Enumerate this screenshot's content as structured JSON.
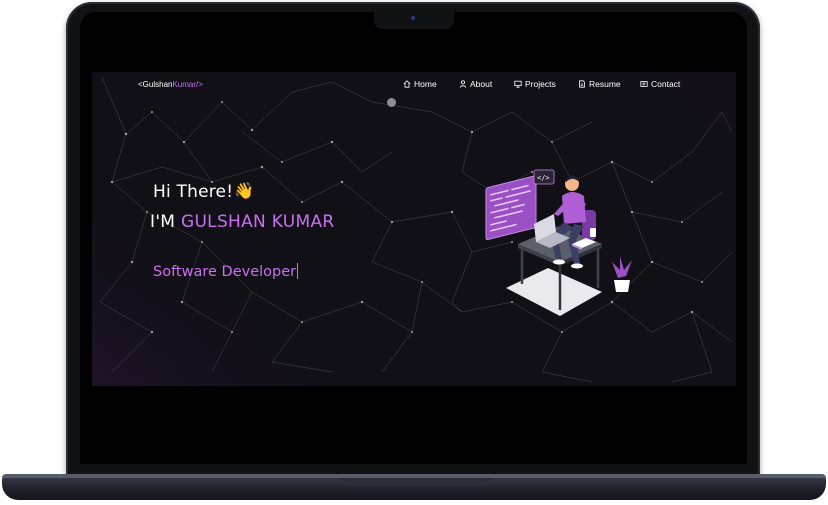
{
  "nav": {
    "logo_prefix": "<Gulshan",
    "logo_accent": "Kumar/>",
    "items": [
      {
        "label": "Home",
        "icon": "home-icon"
      },
      {
        "label": "About",
        "icon": "user-icon"
      },
      {
        "label": "Projects",
        "icon": "projects-icon"
      },
      {
        "label": "Resume",
        "icon": "document-icon"
      },
      {
        "label": "Contact",
        "icon": "contact-icon"
      }
    ]
  },
  "hero": {
    "greeting": "Hi There!",
    "wave_emoji": "👋",
    "name_prefix": "I'M ",
    "name": "GULSHAN KUMAR",
    "typed_role": "Software Developer"
  },
  "colors": {
    "accent": "#c770f0",
    "background": "#121017",
    "text": "#ffffff"
  }
}
